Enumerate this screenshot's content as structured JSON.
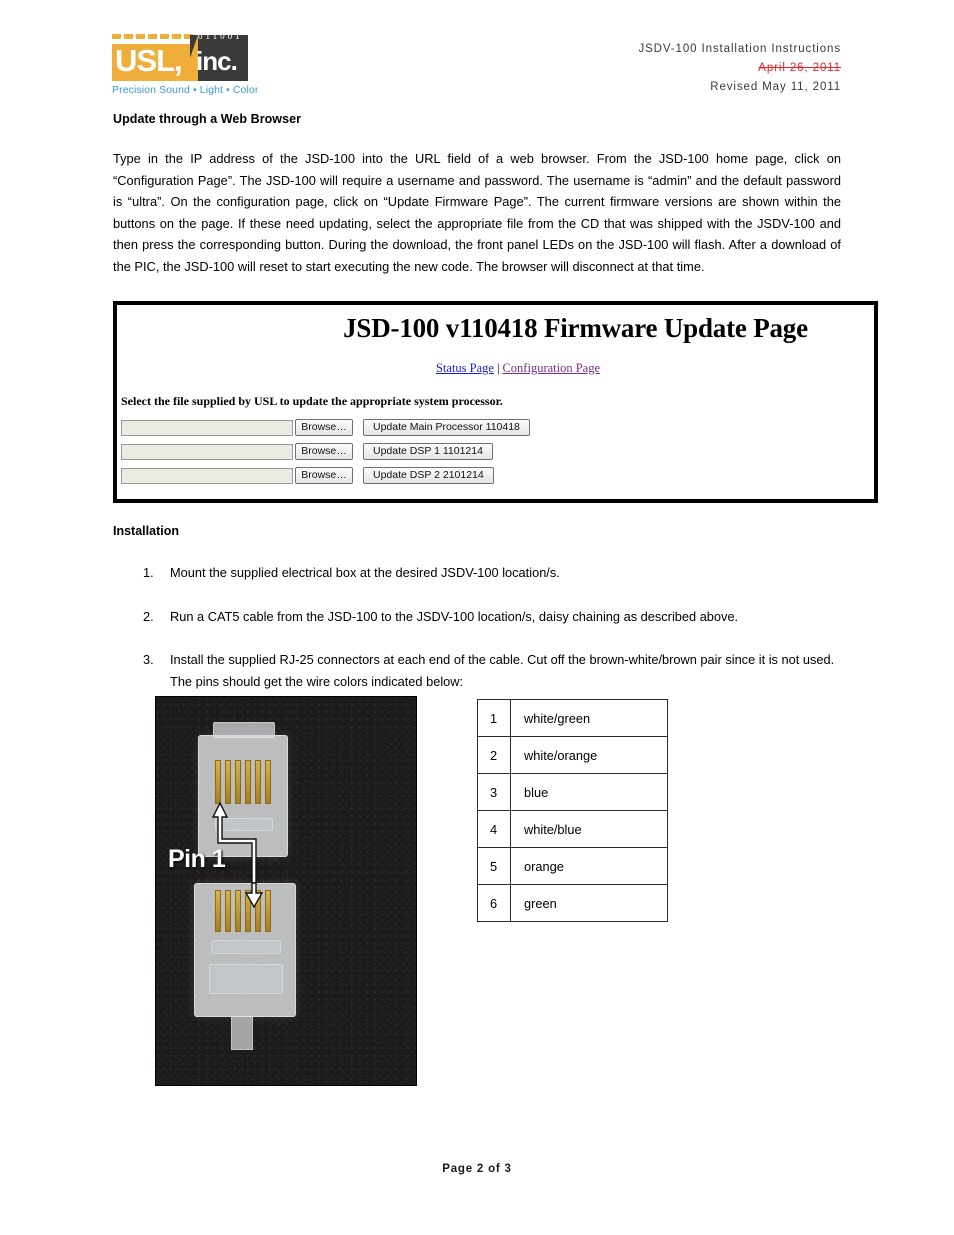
{
  "header": {
    "logo": {
      "bits": "011001",
      "word_left": "USL,",
      "word_right": "inc.",
      "tagline": "Precision Sound • Light • Color",
      "orange": "#EFAE3A",
      "dark": "#3A3A3A",
      "tagline_color": "#3A9BD9"
    },
    "doc_title": "JSDV-100 Installation Instructions",
    "original_date": "April 26, 2011",
    "revised_date": "Revised May 11, 2011",
    "strikethrough_color": "#E8252A"
  },
  "web_browser_section": {
    "title": "Update through a Web Browser",
    "paragraph": "Type in the IP address of the JSD-100 into the URL field of a web browser.  From the JSD-100 home page, click on “Configuration Page”.  The JSD-100 will require a username and password.  The username is “admin” and the default password is “ultra”.  On the configuration page, click on “Update Firmware Page”.  The current firmware versions are shown within the buttons on the page.  If these need updating, select the appropriate file from the CD that was shipped with the JSDV-100 and then press the corresponding button.  During the download, the front panel LEDs on the JSD-100 will flash.  After a download of the PIC, the JSD-100 will reset to start executing the new code.  The browser will disconnect at that time."
  },
  "firmware_screenshot": {
    "title": "JSD-100 v110418 Firmware Update Page",
    "link_status": "Status Page",
    "link_separator": "|",
    "link_config": "Configuration Page",
    "instruction": "Select the file supplied by USL to update the appropriate system processor.",
    "rows": [
      {
        "file_value": "",
        "browse_label": "Browse…",
        "update_label": "Update Main Processor 110418"
      },
      {
        "file_value": "",
        "browse_label": "Browse…",
        "update_label": "Update DSP 1 1101214"
      },
      {
        "file_value": "",
        "browse_label": "Browse…",
        "update_label": "Update DSP 2 2101214"
      }
    ],
    "link_status_color": "#1A1AE0",
    "link_config_color": "#7C2A8F"
  },
  "installation_section": {
    "title": "Installation",
    "steps": [
      {
        "num": "1.",
        "text": "Mount the supplied electrical box at the desired JSDV-100 location/s."
      },
      {
        "num": "2.",
        "text": "Run a CAT5 cable from the JSD-100 to the JSDV-100 location/s, daisy chaining as described above."
      },
      {
        "num": "3.",
        "text": "Install the supplied RJ-25 connectors at each end of the cable. Cut off the brown-white/brown pair since it is not used.  The pins should get the wire colors indicated below:"
      }
    ]
  },
  "connector_photo": {
    "caption": "Pin 1"
  },
  "pin_table": {
    "rows": [
      {
        "pin": "1",
        "color": "white/green"
      },
      {
        "pin": "2",
        "color": "white/orange"
      },
      {
        "pin": "3",
        "color": "blue"
      },
      {
        "pin": "4",
        "color": "white/blue"
      },
      {
        "pin": "5",
        "color": "orange"
      },
      {
        "pin": "6",
        "color": "green"
      }
    ]
  },
  "footer": {
    "page_label": "Page 2 of 3"
  }
}
